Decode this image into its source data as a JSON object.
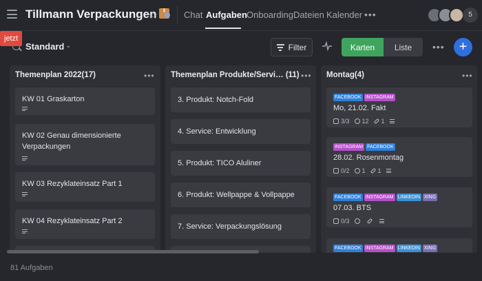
{
  "header": {
    "title": "Tillmann Verpackungen",
    "tabs": [
      {
        "label": "Chat"
      },
      {
        "label": "Aufgaben"
      },
      {
        "label": "Onboarding"
      },
      {
        "label": "Dateien"
      },
      {
        "label": "Kalender"
      }
    ],
    "more": "•••",
    "member_count": "5"
  },
  "toast": "jetzt",
  "toolbar": {
    "view_name": "Standard",
    "filter_label": "Filter",
    "view_cards": "Karten",
    "view_list": "Liste",
    "more": "•••",
    "add": "+"
  },
  "colors": {
    "facebook": "#2f7fd8",
    "instagram": "#b54fc9",
    "linkedin": "#3c8fd6",
    "xing": "#7a6fb0",
    "accent_green": "#3fa45e",
    "accent_blue": "#2f6fe0"
  },
  "columns": [
    {
      "title": "Themenplan 2022(17)",
      "cards": [
        {
          "lines": [
            "KW 01 Graskarton"
          ]
        },
        {
          "lines": [
            "KW 02 Genau dimensionierte",
            "Verpackungen"
          ]
        },
        {
          "lines": [
            "KW 03 Rezyklateinsatz Part 1"
          ]
        },
        {
          "lines": [
            "KW 04 Rezyklateinsatz Part 2"
          ]
        }
      ]
    },
    {
      "title": "Themenplan Produkte/Servi…",
      "count": "(11)",
      "cards": [
        {
          "lines": [
            "3. Produkt: Notch-Fold"
          ]
        },
        {
          "lines": [
            "4. Service: Entwicklung"
          ]
        },
        {
          "lines": [
            "5. Produkt: TICO Aluliner"
          ]
        },
        {
          "lines": [
            "6. Produkt: Wellpappe & Vollpappe"
          ]
        },
        {
          "lines": [
            "7. Service: Verpackungslösung"
          ]
        }
      ]
    },
    {
      "title": "Montag(4)",
      "cards": [
        {
          "tags": [
            "FACEBOOK",
            "INSTAGRAM"
          ],
          "text": "Mo, 21.02. Fakt",
          "meta": {
            "subtasks": "3/3",
            "comments": "12",
            "attachments": "1"
          }
        },
        {
          "tags": [
            "INSTAGRAM",
            "FACEBOOK"
          ],
          "text": "28.02. Rosenmontag",
          "meta": {
            "subtasks": "0/2",
            "comments": "1",
            "attachments": "1"
          }
        },
        {
          "tags": [
            "FACEBOOK",
            "INSTAGRAM",
            "LINKEDIN",
            "XING"
          ],
          "text": "07.03. BTS",
          "meta": {
            "subtasks": "0/3",
            "comments": "",
            "attachments": ""
          }
        },
        {
          "tags": [
            "FACEBOOK",
            "INSTAGRAM",
            "LINKEDIN",
            "XING"
          ]
        }
      ]
    }
  ],
  "footer": "81 Aufgaben"
}
